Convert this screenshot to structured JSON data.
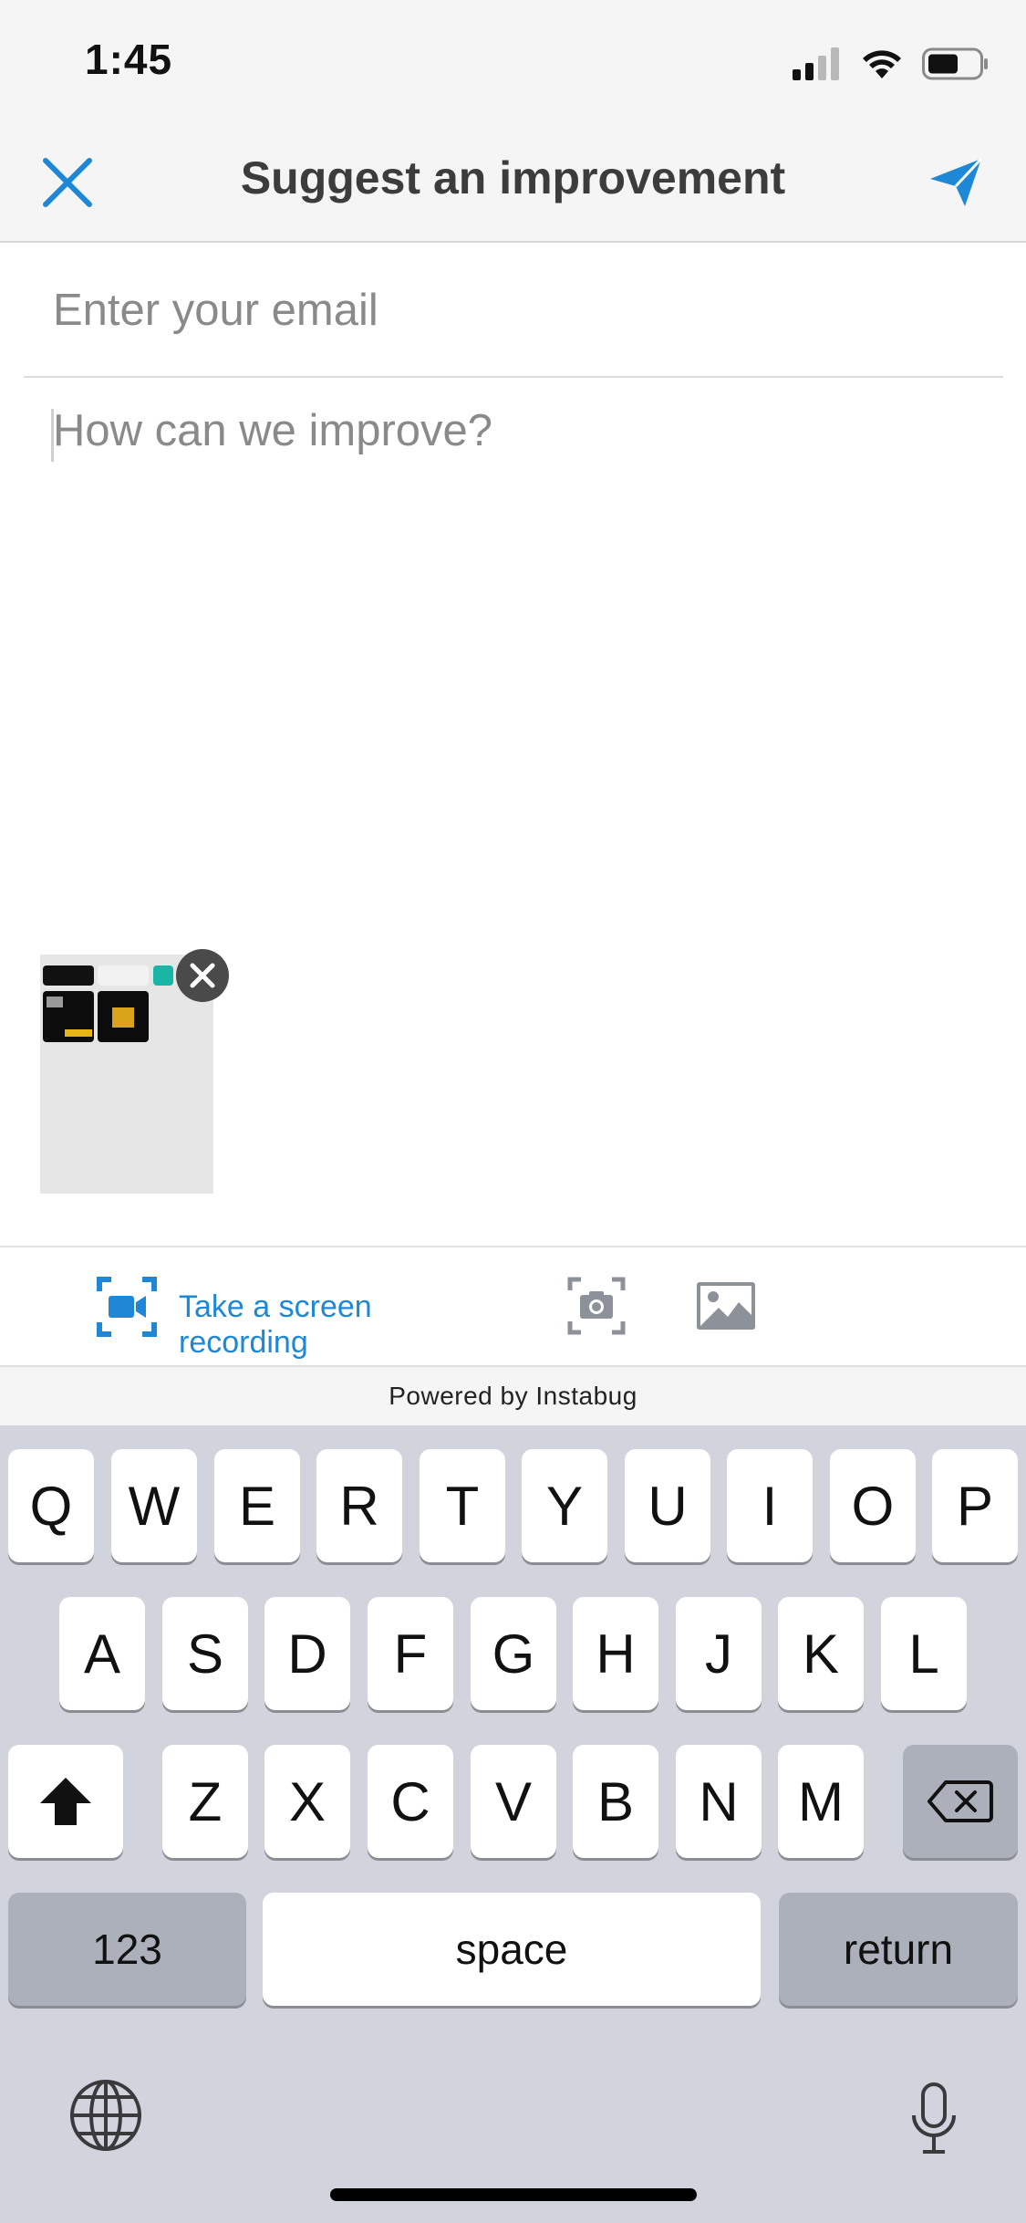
{
  "status_bar": {
    "time": "1:45"
  },
  "nav": {
    "title": "Suggest an improvement"
  },
  "form": {
    "email_placeholder": "Enter your email",
    "message_placeholder": "How can we improve?"
  },
  "attachment_tools": {
    "record_label": "Take a screen recording"
  },
  "footer": {
    "powered_by": "Powered by Instabug"
  },
  "keyboard": {
    "row1": [
      "Q",
      "W",
      "E",
      "R",
      "T",
      "Y",
      "U",
      "I",
      "O",
      "P"
    ],
    "row2": [
      "A",
      "S",
      "D",
      "F",
      "G",
      "H",
      "J",
      "K",
      "L"
    ],
    "row3": [
      "Z",
      "X",
      "C",
      "V",
      "B",
      "N",
      "M"
    ],
    "numbers_label": "123",
    "space_label": "space",
    "return_label": "return"
  },
  "colors": {
    "accent": "#1e88d6",
    "keyboard_bg": "#d1d4dc"
  }
}
